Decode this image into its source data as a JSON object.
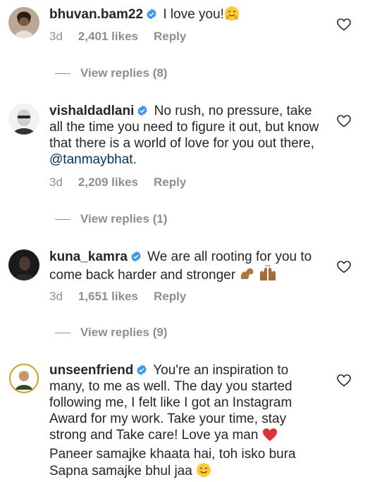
{
  "comments": [
    {
      "username": "bhuvan.bam22",
      "text": " I love you!",
      "emoji": "smiling-hugging-emoji",
      "time": "3d",
      "likes": "2,401 likes",
      "reply": "Reply",
      "view_replies": "View replies (8)"
    },
    {
      "username": "vishaldadlani",
      "text": " No rush, no pressure, take all the time you need to figure it out, but know that there is a world of love for you out there, ",
      "mention": "@tanmaybhat",
      "text_after": ".",
      "time": "3d",
      "likes": "2,209 likes",
      "reply": "Reply",
      "view_replies": "View replies (1)"
    },
    {
      "username": "kuna_kamra",
      "text": " We are all rooting for you to come back harder and stronger ",
      "emoji": "flexed-biceps-raising-hands-emoji",
      "time": "3d",
      "likes": "1,651 likes",
      "reply": "Reply",
      "view_replies": "View replies (9)"
    },
    {
      "username": "unseenfriend",
      "text": " You're an inspiration to many, to me as well. The day you started following me, I felt like I got an Instagram Award for my work. Take your time, stay strong and Take care! Love ya man ",
      "text_after": " Paneer samajke khaata hai, toh isko bura Sapna samajke bhul jaa ",
      "emoji": "red-heart-emoji",
      "emoji_end": "smiling-face-emoji"
    }
  ],
  "colors": {
    "text": "#262626",
    "meta": "#8e8e8e",
    "verified": "#3897f0",
    "mention": "#003569",
    "heart": "#262626"
  }
}
